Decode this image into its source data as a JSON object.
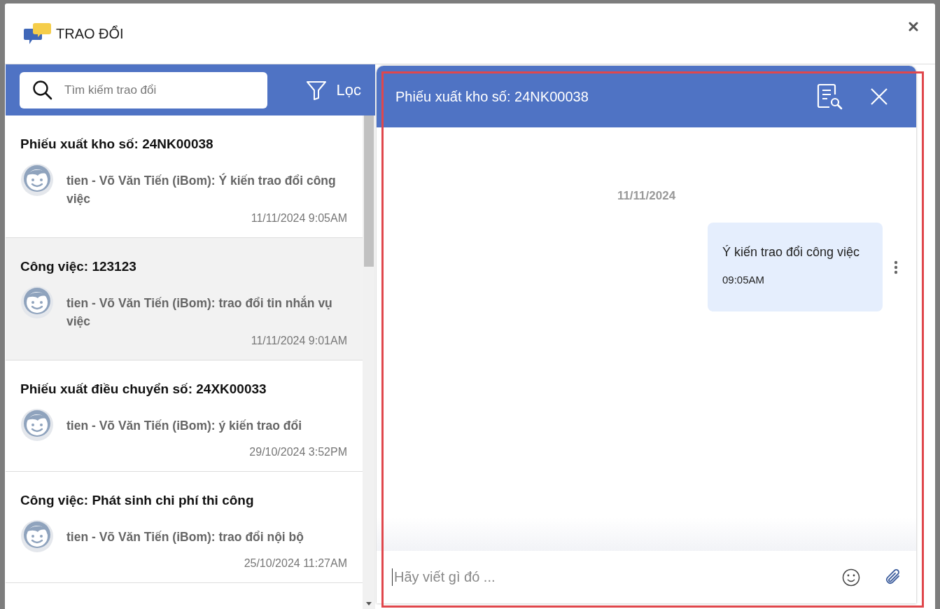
{
  "dialog": {
    "title": "TRAO ĐỔI"
  },
  "search": {
    "placeholder": "Tìm kiếm trao đổi"
  },
  "filter": {
    "label": "Lọc"
  },
  "conversations": [
    {
      "title": "Phiếu xuất kho số: 24NK00038",
      "message": "tien - Võ Văn Tiến (iBom): Ý kiến trao đổi công việc",
      "time": "11/11/2024 9:05AM",
      "selected": false
    },
    {
      "title": "Công việc: 123123",
      "message": "tien - Võ Văn Tiến (iBom): trao đổi tin nhắn vụ việc",
      "time": "11/11/2024 9:01AM",
      "selected": true
    },
    {
      "title": "Phiếu xuất điều chuyển số: 24XK00033",
      "message": "tien - Võ Văn Tiến (iBom): ý kiến trao đổi",
      "time": "29/10/2024 3:52PM",
      "selected": false
    },
    {
      "title": "Công việc: Phát sinh chi phí thi công",
      "message": "tien - Võ Văn Tiến (iBom): trao đổi nội bộ",
      "time": "25/10/2024 11:27AM",
      "selected": false
    }
  ],
  "chat": {
    "title": "Phiếu xuất kho số: 24NK00038",
    "date": "11/11/2024",
    "messages": [
      {
        "text": "Ý kiến trao đổi công việc",
        "time": "09:05AM"
      }
    ],
    "composer": {
      "placeholder": "Hãy viết gì đó ..."
    }
  }
}
